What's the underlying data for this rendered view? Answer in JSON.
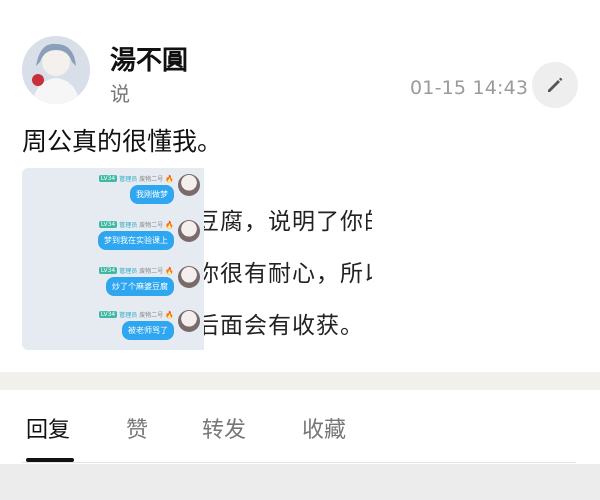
{
  "post": {
    "author": "湯不圓",
    "action": "说",
    "timestamp": "01-15 14:43",
    "content": "周公真的很懂我。",
    "image": {
      "chat": [
        {
          "level": "LV34",
          "role": "管理员",
          "name": "废物二号",
          "message": "我刚做梦"
        },
        {
          "level": "LV34",
          "role": "管理员",
          "name": "废物二号",
          "message": "梦到我在实验课上"
        },
        {
          "level": "LV34",
          "role": "管理员",
          "name": "废物二号",
          "message": "炒了个麻婆豆腐"
        },
        {
          "level": "LV34",
          "role": "管理员",
          "name": "废物二号",
          "message": "被老师骂了"
        }
      ],
      "text_lines": [
        "豆腐，说明了你的",
        "你很有耐心，所以",
        "后面会有收获。"
      ]
    }
  },
  "tabs": [
    {
      "label": "回复",
      "active": true
    },
    {
      "label": "赞",
      "active": false
    },
    {
      "label": "转发",
      "active": false
    },
    {
      "label": "收藏",
      "active": false
    }
  ],
  "colors": {
    "bubble": "#2ea6f0",
    "level_badge": "#3db8a3",
    "divider_band": "#f1f0ed",
    "active_tab": "#111111"
  },
  "icons": {
    "edit": "pencil-icon",
    "avatar": "user-avatar",
    "fire": "fire-icon"
  }
}
